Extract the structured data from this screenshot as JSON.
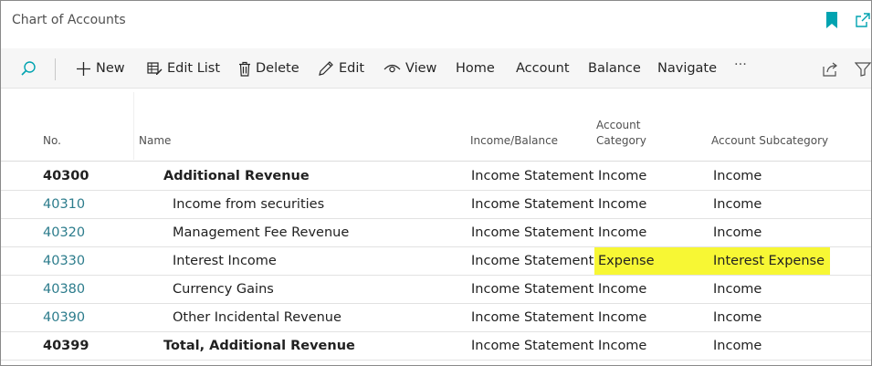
{
  "window": {
    "title": "Chart of Accounts"
  },
  "toolbar": {
    "new": "New",
    "edit_list": "Edit List",
    "delete": "Delete",
    "edit": "Edit",
    "view": "View",
    "home": "Home",
    "account": "Account",
    "balance": "Balance",
    "navigate": "Navigate",
    "more": "···"
  },
  "columns": {
    "no": "No.",
    "name": "Name",
    "income_balance": "Income/Balance",
    "account_category_line1": "Account",
    "account_category_line2": "Category",
    "account_subcategory": "Account Subcategory"
  },
  "rows": [
    {
      "no": "40300",
      "name": "Additional Revenue",
      "income_balance": "Income Statement",
      "category": "Income",
      "subcategory": "Income"
    },
    {
      "no": "40310",
      "name": "Income from securities",
      "income_balance": "Income Statement",
      "category": "Income",
      "subcategory": "Income"
    },
    {
      "no": "40320",
      "name": "Management Fee Revenue",
      "income_balance": "Income Statement",
      "category": "Income",
      "subcategory": "Income"
    },
    {
      "no": "40330",
      "name": "Interest Income",
      "income_balance": "Income Statement",
      "category": "Expense",
      "subcategory": "Interest Expense"
    },
    {
      "no": "40380",
      "name": "Currency Gains",
      "income_balance": "Income Statement",
      "category": "Income",
      "subcategory": "Income"
    },
    {
      "no": "40390",
      "name": "Other Incidental Revenue",
      "income_balance": "Income Statement",
      "category": "Income",
      "subcategory": "Income"
    },
    {
      "no": "40399",
      "name": "Total, Additional Revenue",
      "income_balance": "Income Statement",
      "category": "Income",
      "subcategory": "Income"
    }
  ],
  "colors": {
    "accent": "#00a3b0",
    "link": "#2c7c8c",
    "highlight": "#f7f734"
  }
}
